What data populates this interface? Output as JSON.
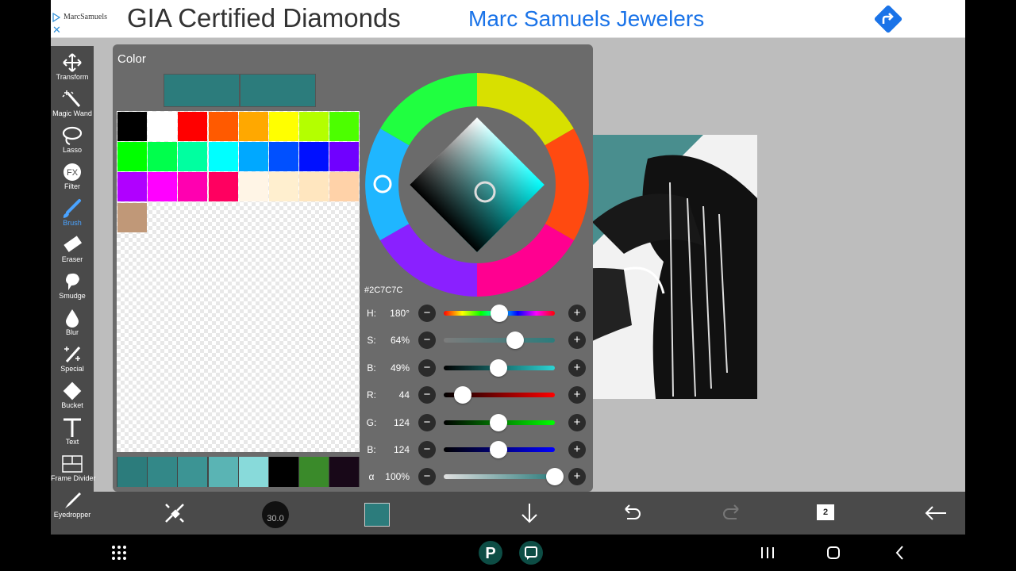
{
  "ad": {
    "logo": "MarcSamuels",
    "headline": "GIA Certified Diamonds",
    "brand": "Marc Samuels Jewelers",
    "close": "✕"
  },
  "toolbar": {
    "tools": [
      {
        "label": "Transform",
        "icon": "move-arrows-icon"
      },
      {
        "label": "Magic Wand",
        "icon": "magic-wand-icon"
      },
      {
        "label": "Lasso",
        "icon": "lasso-icon"
      },
      {
        "label": "Filter",
        "icon": "fx-icon"
      },
      {
        "label": "Brush",
        "icon": "brush-icon",
        "active": true
      },
      {
        "label": "Eraser",
        "icon": "eraser-icon"
      },
      {
        "label": "Smudge",
        "icon": "smudge-icon"
      },
      {
        "label": "Blur",
        "icon": "drop-icon"
      },
      {
        "label": "Special",
        "icon": "sparkle-wand-icon"
      },
      {
        "label": "Bucket",
        "icon": "bucket-icon"
      },
      {
        "label": "Text",
        "icon": "text-icon"
      },
      {
        "label": "Frame Divider",
        "icon": "frame-divider-icon"
      },
      {
        "label": "Eyedropper",
        "icon": "eyedropper-icon"
      }
    ]
  },
  "color_panel": {
    "title": "Color",
    "hex": "#2C7C7C",
    "current_color": "#2c7c7c",
    "palette": [
      "#000000",
      "#ffffff",
      "#ff0000",
      "#ff5a00",
      "#ffa800",
      "#ffff00",
      "#b4ff00",
      "#4cff00",
      "#00ff00",
      "#00ff4c",
      "#00ffa0",
      "#00ffff",
      "#00a8ff",
      "#0050ff",
      "#0010ff",
      "#7000ff",
      "#b000ff",
      "#ff00ff",
      "#ff00b0",
      "#ff0060",
      "#fff5e6",
      "#ffefcf",
      "#ffe6bf",
      "#ffd2a8",
      "#c09878"
    ],
    "history": [
      "#2c7c7c",
      "#338888",
      "#3c9494",
      "#5ab4b4",
      "#88dada",
      "#000000",
      "#3a8a2a",
      "#180818"
    ],
    "sliders": [
      {
        "name": "H:",
        "value": "180°",
        "pos": 0.5
      },
      {
        "name": "S:",
        "value": "64%",
        "pos": 0.64
      },
      {
        "name": "B:",
        "value": "49%",
        "pos": 0.49
      },
      {
        "name": "R:",
        "value": "44",
        "pos": 0.17
      },
      {
        "name": "G:",
        "value": "124",
        "pos": 0.49
      },
      {
        "name": "B:",
        "value": "124",
        "pos": 0.49
      },
      {
        "name": "α",
        "value": "100%",
        "pos": 1.0
      }
    ],
    "minus_label": "−",
    "plus_label": "+"
  },
  "bottombar": {
    "brush_size": "30.0",
    "layer_count": "2"
  }
}
